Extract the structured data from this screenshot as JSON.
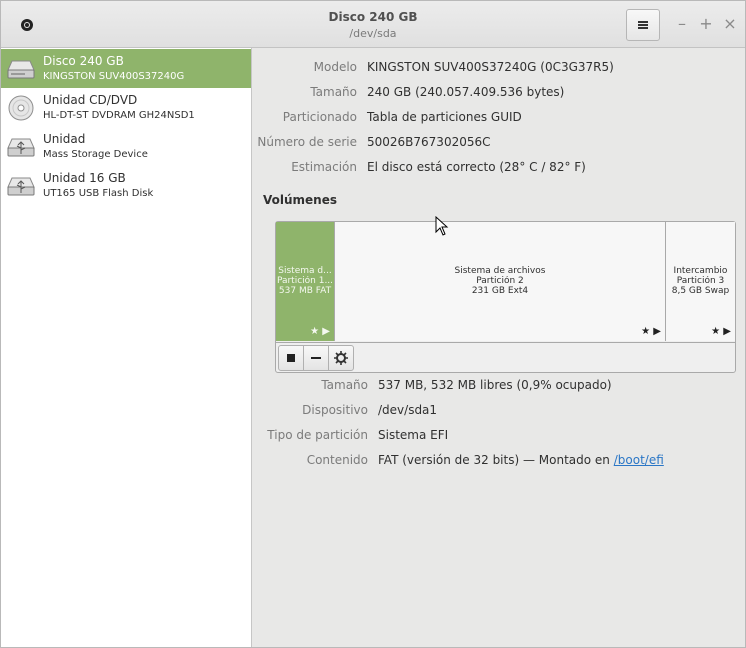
{
  "window": {
    "title": "Disco 240 GB",
    "subtitle": "/dev/sda"
  },
  "icons": {
    "app": "record-icon",
    "menu": "hamburger-icon",
    "minimize": "minimize-icon",
    "maximize": "maximize-icon",
    "close": "close-icon"
  },
  "controls": {
    "minimize": "–",
    "maximize": "+",
    "close": "×"
  },
  "sidebar": {
    "items": [
      {
        "name": "Disco 240 GB",
        "sub": "KINGSTON SUV400S37240G",
        "icon": "hard-disk-icon",
        "selected": true
      },
      {
        "name": "Unidad CD/DVD",
        "sub": "HL-DT-ST DVDRAM GH24NSD1",
        "icon": "optical-disc-icon",
        "selected": false
      },
      {
        "name": "Unidad",
        "sub": "Mass Storage Device",
        "icon": "usb-drive-icon",
        "selected": false
      },
      {
        "name": "Unidad 16 GB",
        "sub": "UT165 USB Flash Disk",
        "icon": "usb-drive-icon",
        "selected": false
      }
    ]
  },
  "disk": {
    "model_label": "Modelo",
    "model": "KINGSTON SUV400S37240G (0C3G37R5)",
    "size_label": "Tamaño",
    "size": "240 GB (240.057.409.536 bytes)",
    "partitioning_label": "Particionado",
    "partitioning": "Tabla de particiones GUID",
    "serial_label": "Número de serie",
    "serial": "50026B767302056C",
    "assessment_label": "Estimación",
    "assessment": "El disco está correcto (28° C / 82° F)"
  },
  "volumes": {
    "heading": "Volúmenes",
    "partitions": [
      {
        "line1": "Sistema d...",
        "line2": "Partición 1...",
        "line3": "537 MB FAT",
        "selected": true
      },
      {
        "line1": "Sistema de archivos",
        "line2": "Partición 2",
        "line3": "231 GB Ext4",
        "selected": false
      },
      {
        "line1": "Intercambio",
        "line2": "Partición 3",
        "line3": "8,5 GB Swap",
        "selected": false
      }
    ],
    "partition_marks": "★ ▶",
    "toolbar": [
      "stop-icon",
      "minus-icon",
      "gear-icon"
    ]
  },
  "selected_volume": {
    "size_label": "Tamaño",
    "size": "537 MB, 532 MB libres (0,9% ocupado)",
    "device_label": "Dispositivo",
    "device": "/dev/sda1",
    "type_label": "Tipo de partición",
    "type": "Sistema EFI",
    "contents_label": "Contenido",
    "contents_prefix": "FAT (versión de 32 bits) — Montado en",
    "mount_link": "/boot/efi"
  },
  "colors": {
    "accent": "#8fb46b",
    "link": "#2a76c6"
  }
}
